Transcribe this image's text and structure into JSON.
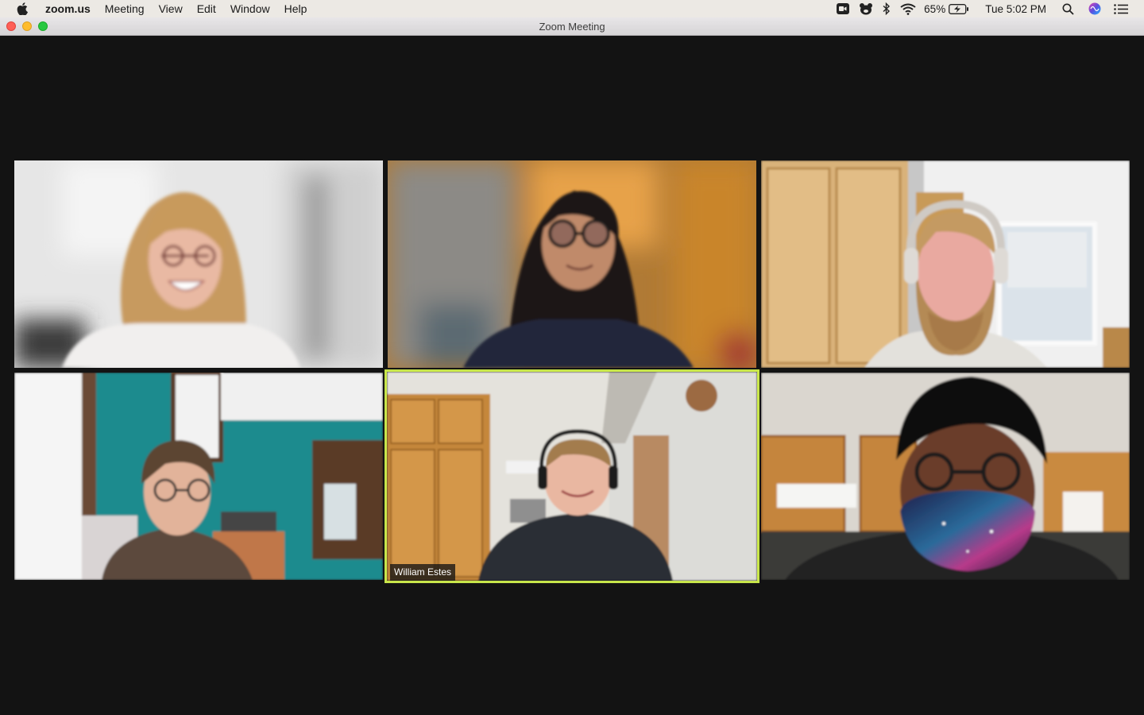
{
  "menubar": {
    "apple_icon": "apple-logo-icon",
    "items": [
      {
        "label": "zoom.us",
        "bold": true
      },
      {
        "label": "Meeting"
      },
      {
        "label": "View"
      },
      {
        "label": "Edit"
      },
      {
        "label": "Window"
      },
      {
        "label": "Help"
      }
    ],
    "status": {
      "icons": [
        "zoom-camera-icon",
        "bear-icon",
        "bluetooth-icon",
        "wifi-icon",
        "battery-charging-icon",
        "search-icon",
        "siri-icon",
        "notification-center-icon"
      ],
      "battery_percent": "65%",
      "clock": "Tue 5:02 PM"
    }
  },
  "window": {
    "title": "Zoom Meeting"
  },
  "gallery": {
    "active_speaker_color": "#c8e64a",
    "tiles": [
      {
        "row": 0,
        "col": 0,
        "name": "",
        "active": false
      },
      {
        "row": 0,
        "col": 1,
        "name": "",
        "active": false
      },
      {
        "row": 0,
        "col": 2,
        "name": "",
        "active": false
      },
      {
        "row": 1,
        "col": 0,
        "name": "",
        "active": false
      },
      {
        "row": 1,
        "col": 1,
        "name": "William Estes",
        "active": true
      },
      {
        "row": 1,
        "col": 2,
        "name": "",
        "active": false
      }
    ]
  }
}
